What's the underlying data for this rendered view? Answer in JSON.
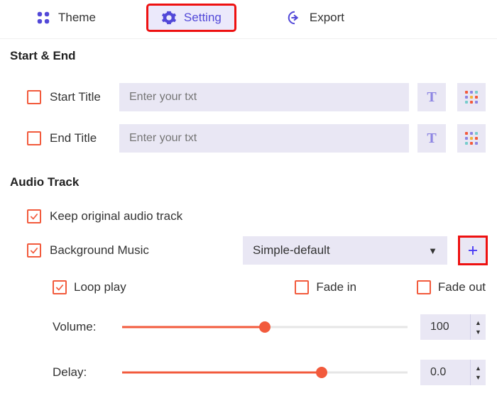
{
  "tabs": {
    "theme": "Theme",
    "setting": "Setting",
    "export": "Export"
  },
  "sections": {
    "start_end": "Start & End",
    "audio_track": "Audio Track"
  },
  "start_end": {
    "start_title_label": "Start Title",
    "end_title_label": "End Title",
    "placeholder": "Enter your txt"
  },
  "audio": {
    "keep_original_label": "Keep original audio track",
    "bg_music_label": "Background Music",
    "bg_music_selected": "Simple-default",
    "loop_label": "Loop play",
    "fade_in_label": "Fade in",
    "fade_out_label": "Fade out",
    "volume_label": "Volume:",
    "delay_label": "Delay:",
    "volume_value": "100",
    "delay_value": "0.0",
    "volume_pct": 50,
    "delay_pct": 70
  }
}
